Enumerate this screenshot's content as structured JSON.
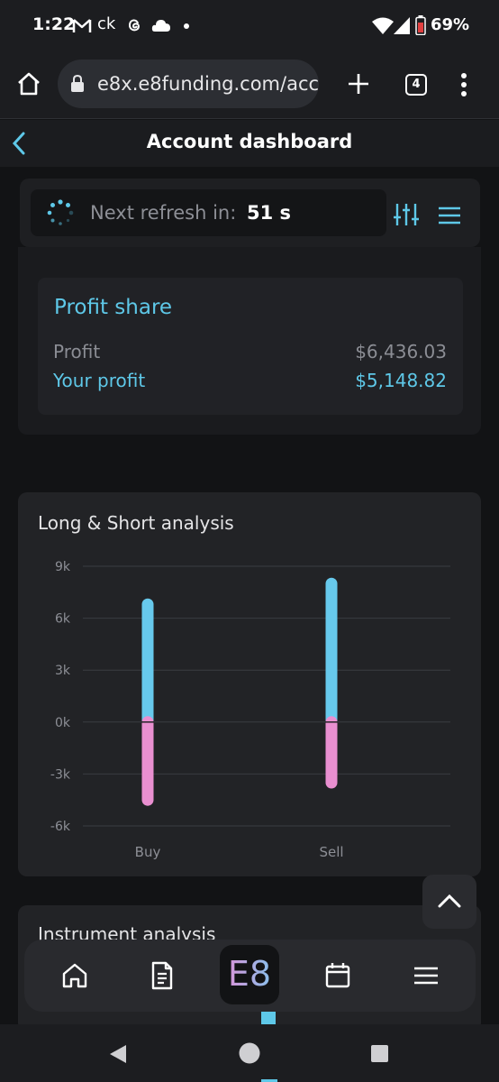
{
  "status_bar": {
    "time": "1:22",
    "notifications": [
      "gmail-icon",
      "ck",
      "threads-icon",
      "cloud-icon",
      "dot"
    ],
    "ck_label": "ck",
    "battery": "69%"
  },
  "browser": {
    "url": "e8x.e8funding.com/acco",
    "tab_count": "4"
  },
  "header": {
    "title": "Account dashboard"
  },
  "refresh": {
    "label": "Next refresh in:",
    "value": "51 s"
  },
  "profit_share": {
    "title": "Profit share",
    "rows": [
      {
        "label": "Profit",
        "value": "$6,436.03"
      },
      {
        "label": "Your profit",
        "value": "$5,148.82"
      }
    ]
  },
  "chart_data": {
    "type": "bar",
    "title": "Long & Short analysis",
    "categories": [
      "Buy",
      "Sell"
    ],
    "series": [
      {
        "values": [
          6800,
          8000
        ],
        "color": "#67c9ec"
      },
      {
        "values": [
          -4500,
          -3500
        ],
        "color": "#e98fd0"
      }
    ],
    "yticks": [
      "9k",
      "6k",
      "3k",
      "0k",
      "-3k",
      "-6k"
    ],
    "ytick_values": [
      9000,
      6000,
      3000,
      0,
      -3000,
      -6000
    ],
    "ylim": [
      -6000,
      9000
    ],
    "grid": true
  },
  "instrument": {
    "title": "Instrument analysis"
  },
  "nav": {
    "logo": "E8",
    "items": [
      "home-icon",
      "document-icon",
      "e8-logo",
      "calendar-icon",
      "menu-icon"
    ]
  },
  "colors": {
    "accent": "#5ec8e8",
    "pink": "#e98fd0",
    "background": "#121315",
    "card": "#222326"
  }
}
